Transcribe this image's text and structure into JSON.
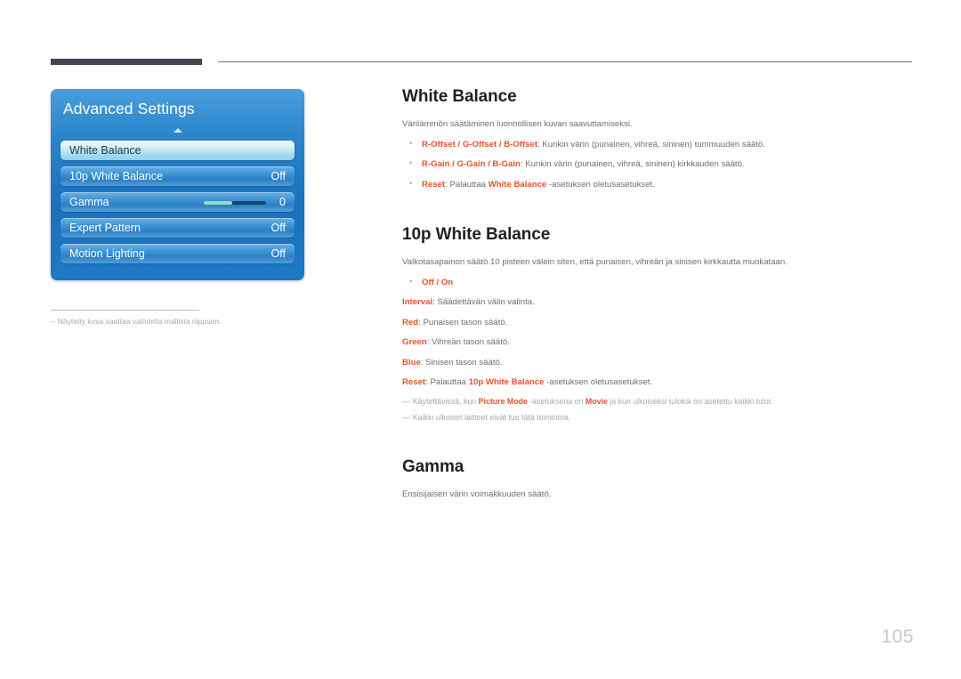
{
  "page": {
    "number": "105"
  },
  "osd": {
    "title": "Advanced Settings",
    "rows": [
      {
        "label": "White Balance",
        "value": "",
        "selected": true,
        "slider": false
      },
      {
        "label": "10p White Balance",
        "value": "Off",
        "selected": false,
        "slider": false
      },
      {
        "label": "Gamma",
        "value": "0",
        "selected": false,
        "slider": true
      },
      {
        "label": "Expert Pattern",
        "value": "Off",
        "selected": false,
        "slider": false
      },
      {
        "label": "Motion Lighting",
        "value": "Off",
        "selected": false,
        "slider": false
      }
    ],
    "colors": {
      "panel_blue": "#1a71be",
      "row_blue": "#3e93d6",
      "selected_row": "#a9dcec",
      "slider_fill": "#8fe0c0"
    }
  },
  "left_note": {
    "dash": "–",
    "text": "Näytetty kuva saattaa vaihdella mallista riippuen."
  },
  "sections": {
    "white_balance": {
      "title": "White Balance",
      "intro": "Värilämmön säätäminen luonnollisen kuvan saavuttamiseksi.",
      "bullets": [
        {
          "lead": "R-Offset / G-Offset / B-Offset",
          "rest": ": Kunkin värin (punainen, vihreä, sininen) tummuuden säätö."
        },
        {
          "lead": "R-Gain / G-Gain / B-Gain",
          "rest": ": Kunkin värin (punainen, vihreä, sininen) kirkkauden säätö."
        },
        {
          "lead": "Reset",
          "mid": ": Palauttaa ",
          "hl2": "White Balance",
          "rest": " -asetuksen oletusasetukset."
        }
      ]
    },
    "tenp_white_balance": {
      "title": "10p White Balance",
      "intro": "Valkotasapainon säätö 10 pisteen välein siten, että punaisen, vihreän ja sinisen kirkkautta muokataan.",
      "bullet_off_on": "Off / On",
      "lines": [
        {
          "lead": "Interval",
          "rest": ": Säädettävän välin valinta."
        },
        {
          "lead": "Red",
          "rest": ": Punaisen tason säätö."
        },
        {
          "lead": "Green",
          "rest": ": Vihreän tason säätö."
        },
        {
          "lead": "Blue",
          "rest": ": Sinisen tason säätö."
        }
      ],
      "reset_line": {
        "lead": "Reset",
        "mid": ": Palauttaa ",
        "hl2": "10p White Balance",
        "rest": " -asetuksen oletusasetukset."
      },
      "notes": [
        {
          "dash": "―",
          "a": "Käytettävissä, kun ",
          "hl1": "Picture Mode",
          "b": " -asetuksena on ",
          "hl2": "Movie",
          "c": " ja kun ulkoiseksi tuloksi on asetettu kaikki tulot."
        },
        {
          "dash": "―",
          "a": "Kaikki ulkoiset laitteet eivät tue tätä toimintoa.",
          "hl1": "",
          "b": "",
          "hl2": "",
          "c": ""
        }
      ]
    },
    "gamma": {
      "title": "Gamma",
      "intro": "Ensisijaisen värin voimakkuuden säätö."
    }
  }
}
